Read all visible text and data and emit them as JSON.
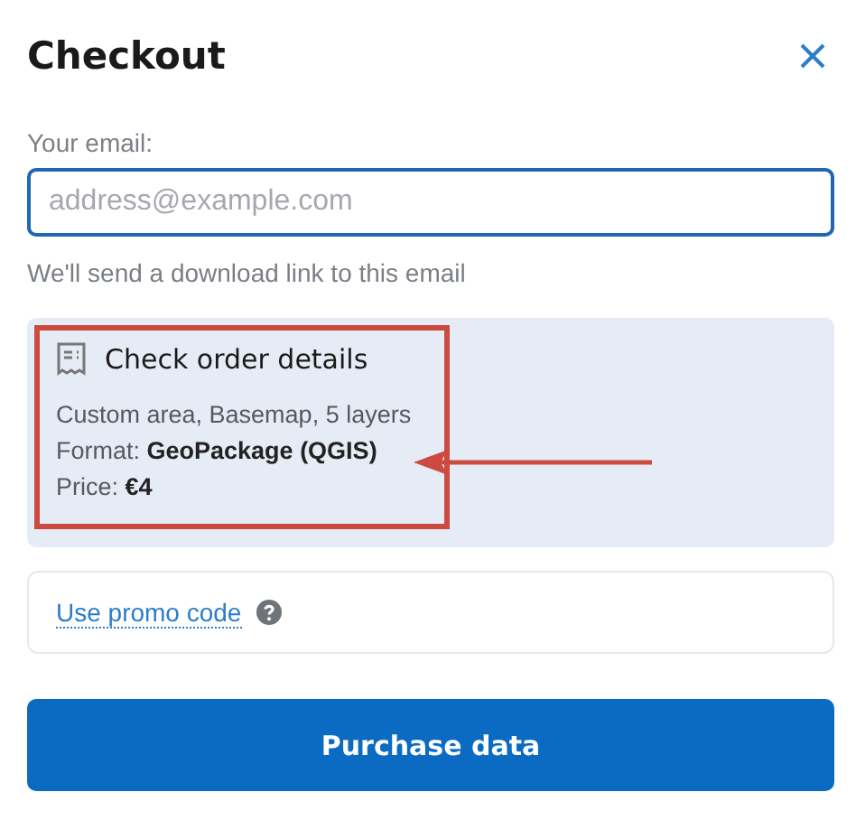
{
  "title": "Checkout",
  "email": {
    "label": "Your email:",
    "placeholder": "address@example.com",
    "hint": "We'll send a download link to this email"
  },
  "order": {
    "heading": "Check order details",
    "highlighted": true,
    "lines": [
      "Custom area, Basemap, 5 layers",
      "Format: **GeoPackage (QGIS)**",
      "Price: **€4**"
    ]
  },
  "promo": {
    "link": "Use promo code"
  },
  "button": "Purchase data"
}
